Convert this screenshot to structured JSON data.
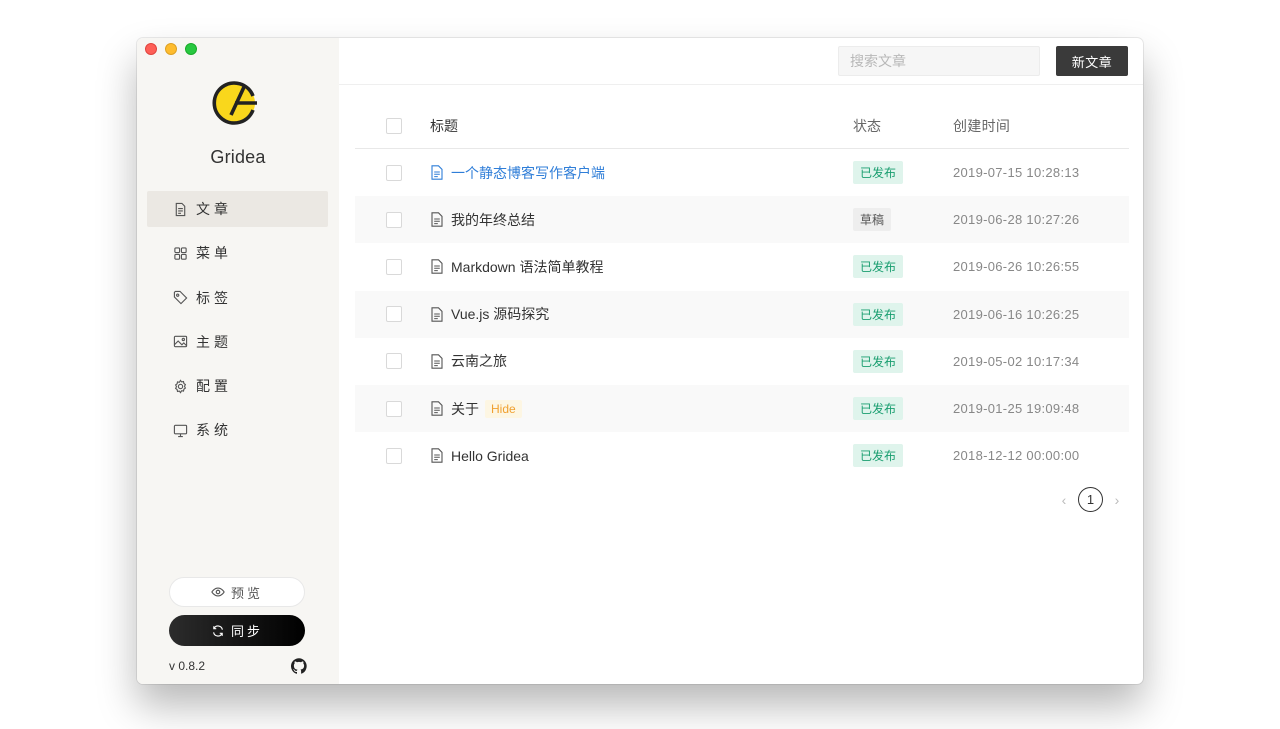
{
  "app": {
    "name": "Gridea",
    "version": "v 0.8.2"
  },
  "sidebar": {
    "items": [
      {
        "label": "文章",
        "icon": "article-icon",
        "active": true
      },
      {
        "label": "菜单",
        "icon": "menu-grid-icon",
        "active": false
      },
      {
        "label": "标签",
        "icon": "tag-icon",
        "active": false
      },
      {
        "label": "主题",
        "icon": "image-icon",
        "active": false
      },
      {
        "label": "配置",
        "icon": "gear-icon",
        "active": false
      },
      {
        "label": "系统",
        "icon": "monitor-icon",
        "active": false
      }
    ],
    "preview_label": "预览",
    "sync_label": "同步"
  },
  "toolbar": {
    "search_placeholder": "搜索文章",
    "new_label": "新文章"
  },
  "table": {
    "headers": {
      "title": "标题",
      "status": "状态",
      "date": "创建时间"
    },
    "rows": [
      {
        "title": "一个静态博客写作客户端",
        "status": "已发布",
        "date": "2019-07-15 10:28:13",
        "hide": "",
        "link": true
      },
      {
        "title": "我的年终总结",
        "status": "草稿",
        "date": "2019-06-28 10:27:26",
        "hide": "",
        "link": false
      },
      {
        "title": "Markdown 语法简单教程",
        "status": "已发布",
        "date": "2019-06-26 10:26:55",
        "hide": "",
        "link": false
      },
      {
        "title": "Vue.js 源码探究",
        "status": "已发布",
        "date": "2019-06-16 10:26:25",
        "hide": "",
        "link": false
      },
      {
        "title": "云南之旅",
        "status": "已发布",
        "date": "2019-05-02 10:17:34",
        "hide": "",
        "link": false
      },
      {
        "title": "关于",
        "status": "已发布",
        "date": "2019-01-25 19:09:48",
        "hide": "Hide",
        "link": false
      },
      {
        "title": "Hello Gridea",
        "status": "已发布",
        "date": "2018-12-12 00:00:00",
        "hide": "",
        "link": false
      }
    ]
  },
  "pagination": {
    "current": "1",
    "prev": "‹",
    "next": "›"
  },
  "colors": {
    "accent": "#2f7ed8",
    "published_bg": "#dff4ec",
    "published_fg": "#1a9e70",
    "logo_yellow": "#f9d71c"
  }
}
